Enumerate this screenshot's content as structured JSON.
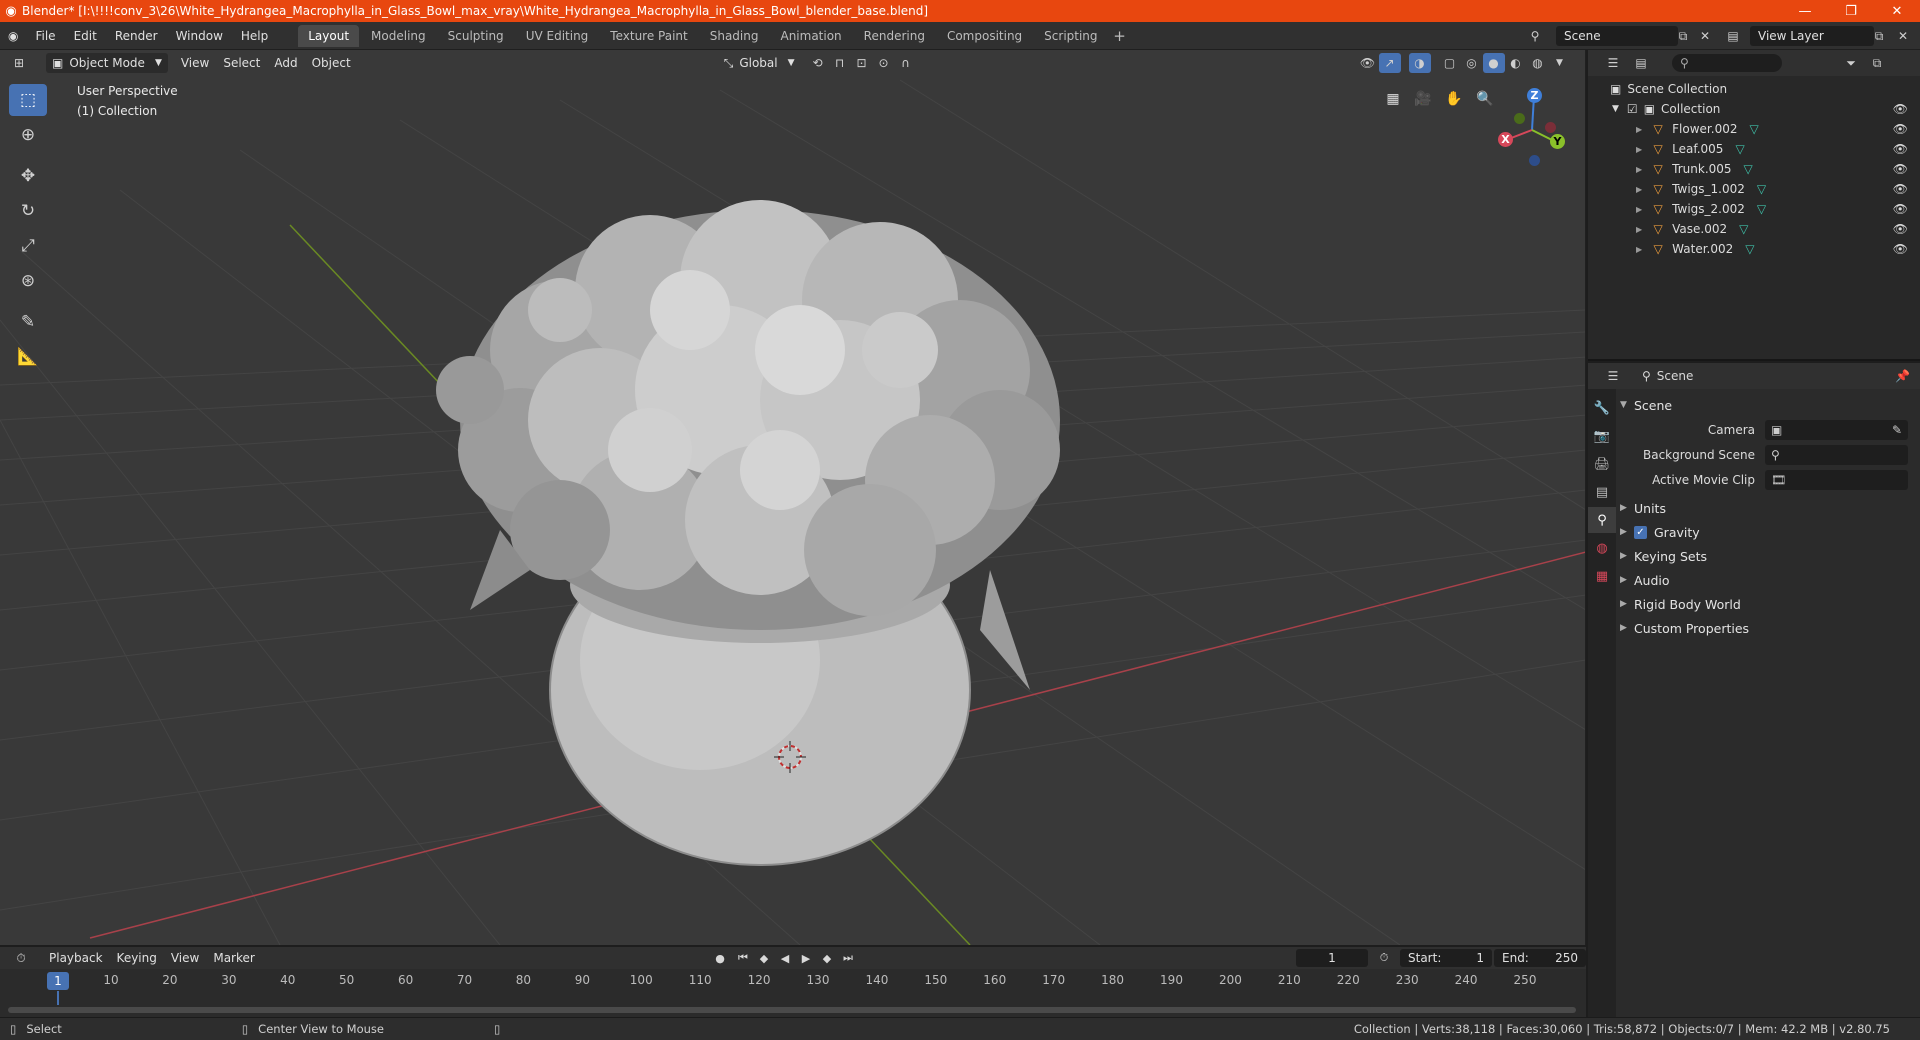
{
  "titlebar": {
    "title": "Blender* [I:\\!!!!conv_3\\26\\White_Hydrangea_Macrophylla_in_Glass_Bowl_max_vray\\White_Hydrangea_Macrophylla_in_Glass_Bowl_blender_base.blend]",
    "minimize": "—",
    "maximize": "❐",
    "close": "✕"
  },
  "menu": {
    "items": [
      "File",
      "Edit",
      "Render",
      "Window",
      "Help"
    ],
    "workspaces": [
      "Layout",
      "Modeling",
      "Sculpting",
      "UV Editing",
      "Texture Paint",
      "Shading",
      "Animation",
      "Rendering",
      "Compositing",
      "Scripting"
    ],
    "active_workspace": "Layout",
    "add": "+",
    "scene": "Scene",
    "view_layer": "View Layer"
  },
  "viewport": {
    "mode": "Object Mode",
    "menus": [
      "View",
      "Select",
      "Add",
      "Object"
    ],
    "transform_orientation": "Global",
    "perspective": "User Perspective",
    "collection": "(1) Collection",
    "gizmo": {
      "x": "X",
      "y": "Y",
      "z": "Z"
    }
  },
  "outliner": {
    "root": "Scene Collection",
    "collection": "Collection",
    "objects": [
      "Flower.002",
      "Leaf.005",
      "Trunk.005",
      "Twigs_1.002",
      "Twigs_2.002",
      "Vase.002",
      "Water.002"
    ]
  },
  "properties": {
    "context": "Scene",
    "section": "Scene",
    "fields": {
      "camera": "Camera",
      "background_scene": "Background Scene",
      "active_movie_clip": "Active Movie Clip"
    },
    "subsections": [
      "Units",
      "Gravity",
      "Keying Sets",
      "Audio",
      "Rigid Body World",
      "Custom Properties"
    ],
    "gravity_enabled": true
  },
  "timeline": {
    "menus": [
      "Playback",
      "Keying",
      "View",
      "Marker"
    ],
    "current_frame": "1",
    "start_label": "Start:",
    "start": "1",
    "end_label": "End:",
    "end": "250",
    "ticks": [
      "10",
      "20",
      "30",
      "40",
      "50",
      "60",
      "70",
      "80",
      "90",
      "100",
      "110",
      "120",
      "130",
      "140",
      "150",
      "160",
      "170",
      "180",
      "190",
      "200",
      "210",
      "220",
      "230",
      "240",
      "250"
    ]
  },
  "statusbar": {
    "select": "Select",
    "center_view": "Center View to Mouse",
    "stats": "Collection | Verts:38,118 | Faces:30,060 | Tris:58,872 | Objects:0/7 | Mem: 42.2 MB | v2.80.75"
  },
  "colors": {
    "titlebar": "#e8470f",
    "accent": "#4772b3",
    "axis_x": "#d6485a",
    "axis_y": "#8ac02a",
    "axis_z": "#3f7fd9"
  }
}
